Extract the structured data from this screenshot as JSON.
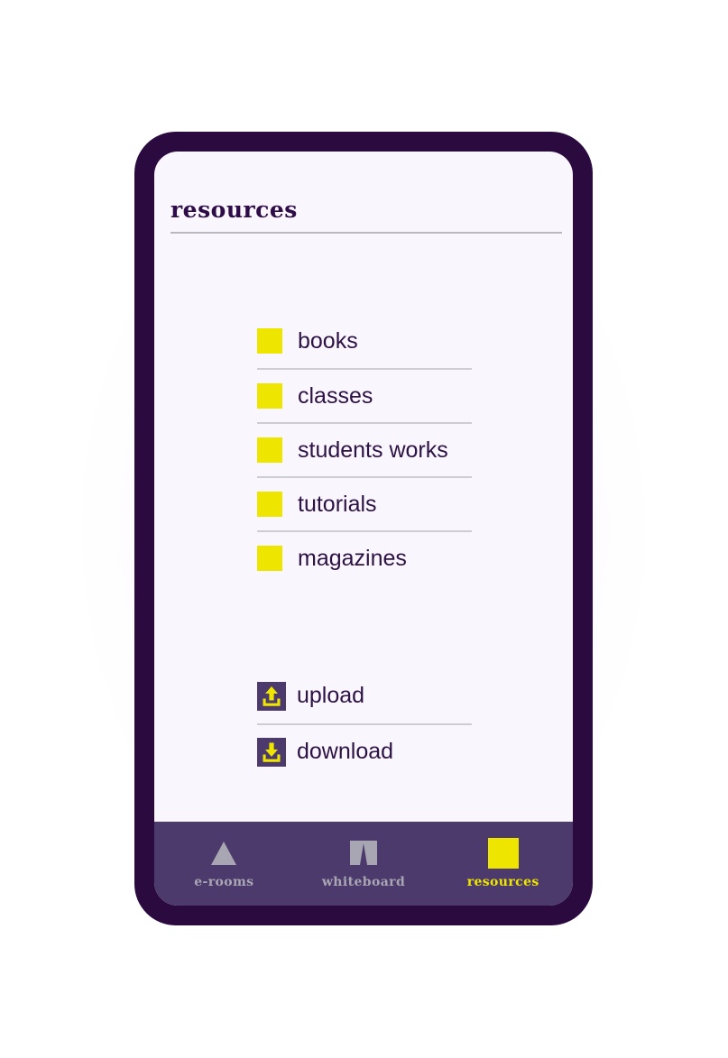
{
  "screen": {
    "title": "resources",
    "background_color": "#f9f7fd",
    "accent_color": "#eee600",
    "text_color": "#2d1245",
    "bezel_color": "#2a0a3f",
    "nav_background_color": "#4b3a6b"
  },
  "resources": {
    "items": [
      {
        "label": "books",
        "marker": "yellow-square-icon"
      },
      {
        "label": "classes",
        "marker": "yellow-square-icon"
      },
      {
        "label": "students works",
        "marker": "yellow-square-icon"
      },
      {
        "label": "tutorials",
        "marker": "yellow-square-icon"
      },
      {
        "label": "magazines",
        "marker": "yellow-square-icon"
      }
    ]
  },
  "transfer": {
    "items": [
      {
        "label": "upload",
        "icon": "upload-icon"
      },
      {
        "label": "download",
        "icon": "download-icon"
      }
    ]
  },
  "bottom_nav": {
    "items": [
      {
        "label": "e-rooms",
        "icon": "triangle-icon",
        "active": false
      },
      {
        "label": "whiteboard",
        "icon": "whiteboard-peaks-icon",
        "active": false
      },
      {
        "label": "resources",
        "icon": "yellow-square-icon",
        "active": true
      }
    ]
  }
}
